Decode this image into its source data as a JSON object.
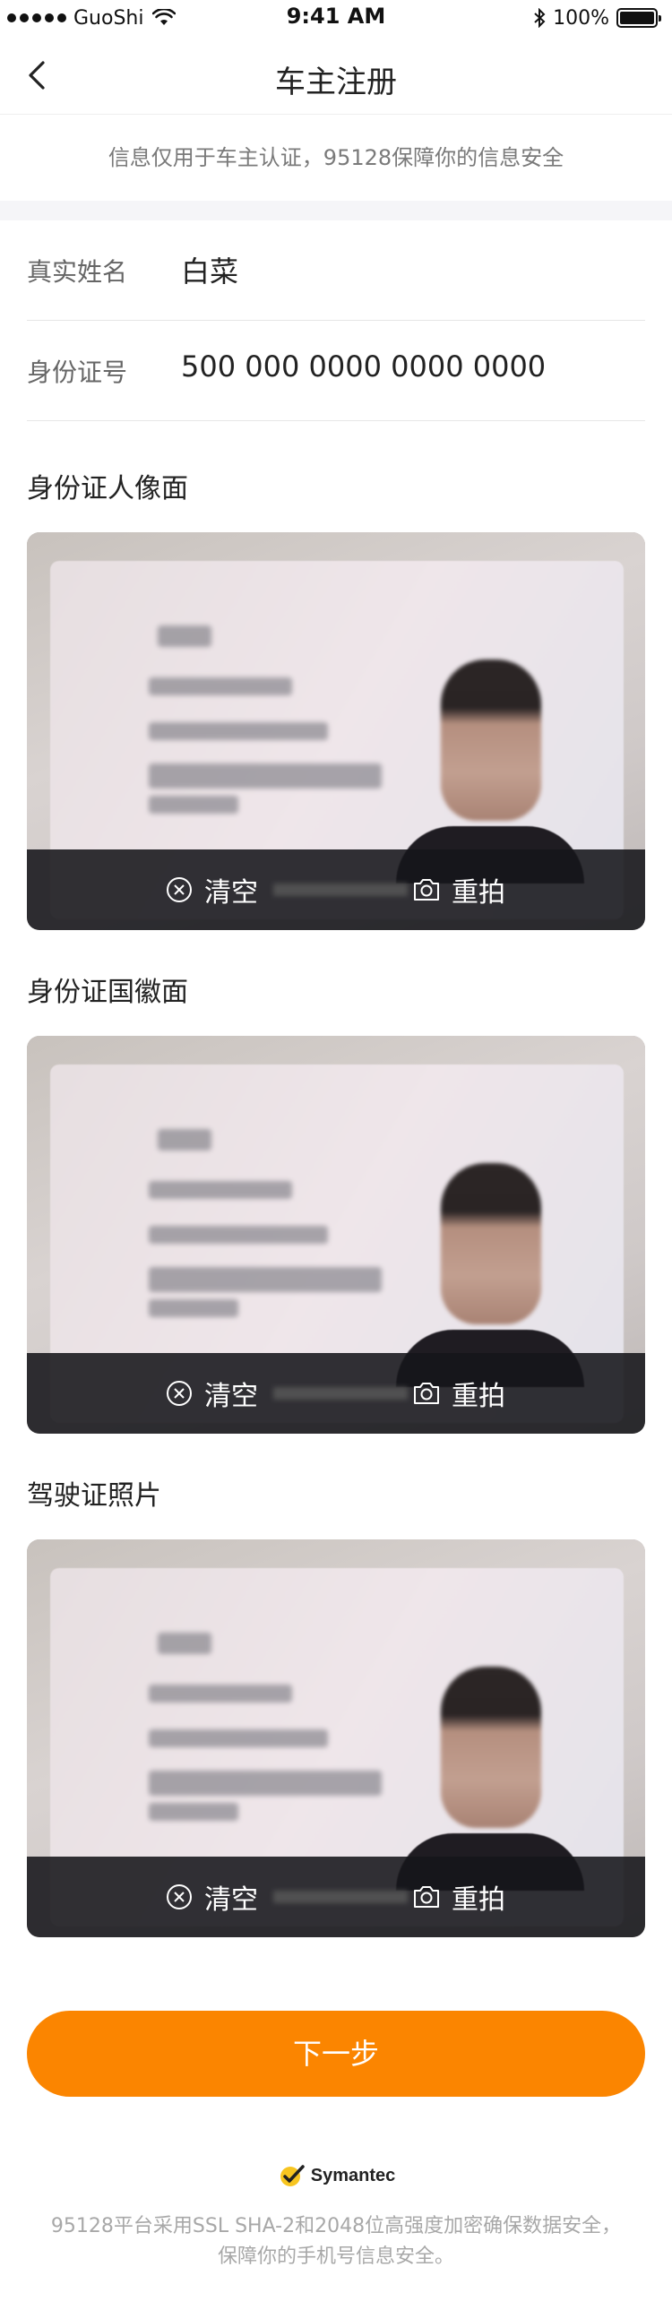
{
  "status_bar": {
    "carrier": "GuoShi",
    "time": "9:41 AM",
    "battery": "100%"
  },
  "nav": {
    "title": "车主注册",
    "back_icon": "chevron-left-icon"
  },
  "notice": "信息仅用于车主认证，95128保障你的信息安全",
  "form": {
    "name_label": "真实姓名",
    "name_value": "白菜",
    "id_label": "身份证号",
    "id_value": "500 000 0000 0000 0000"
  },
  "photos": [
    {
      "title": "身份证人像面",
      "clear_label": "清空",
      "retake_label": "重拍"
    },
    {
      "title": "身份证国徽面",
      "clear_label": "清空",
      "retake_label": "重拍"
    },
    {
      "title": "驾驶证照片",
      "clear_label": "清空",
      "retake_label": "重拍"
    }
  ],
  "next_button": "下一步",
  "footer": {
    "brand": "Symantec",
    "line1": "95128平台采用SSL SHA-2和2048位高强度加密确保数据安全，",
    "line2": "保障你的手机号信息安全。"
  },
  "colors": {
    "accent": "#fb8500",
    "notice_text": "#7a7a7a",
    "footer_text": "#a8a8a8"
  }
}
